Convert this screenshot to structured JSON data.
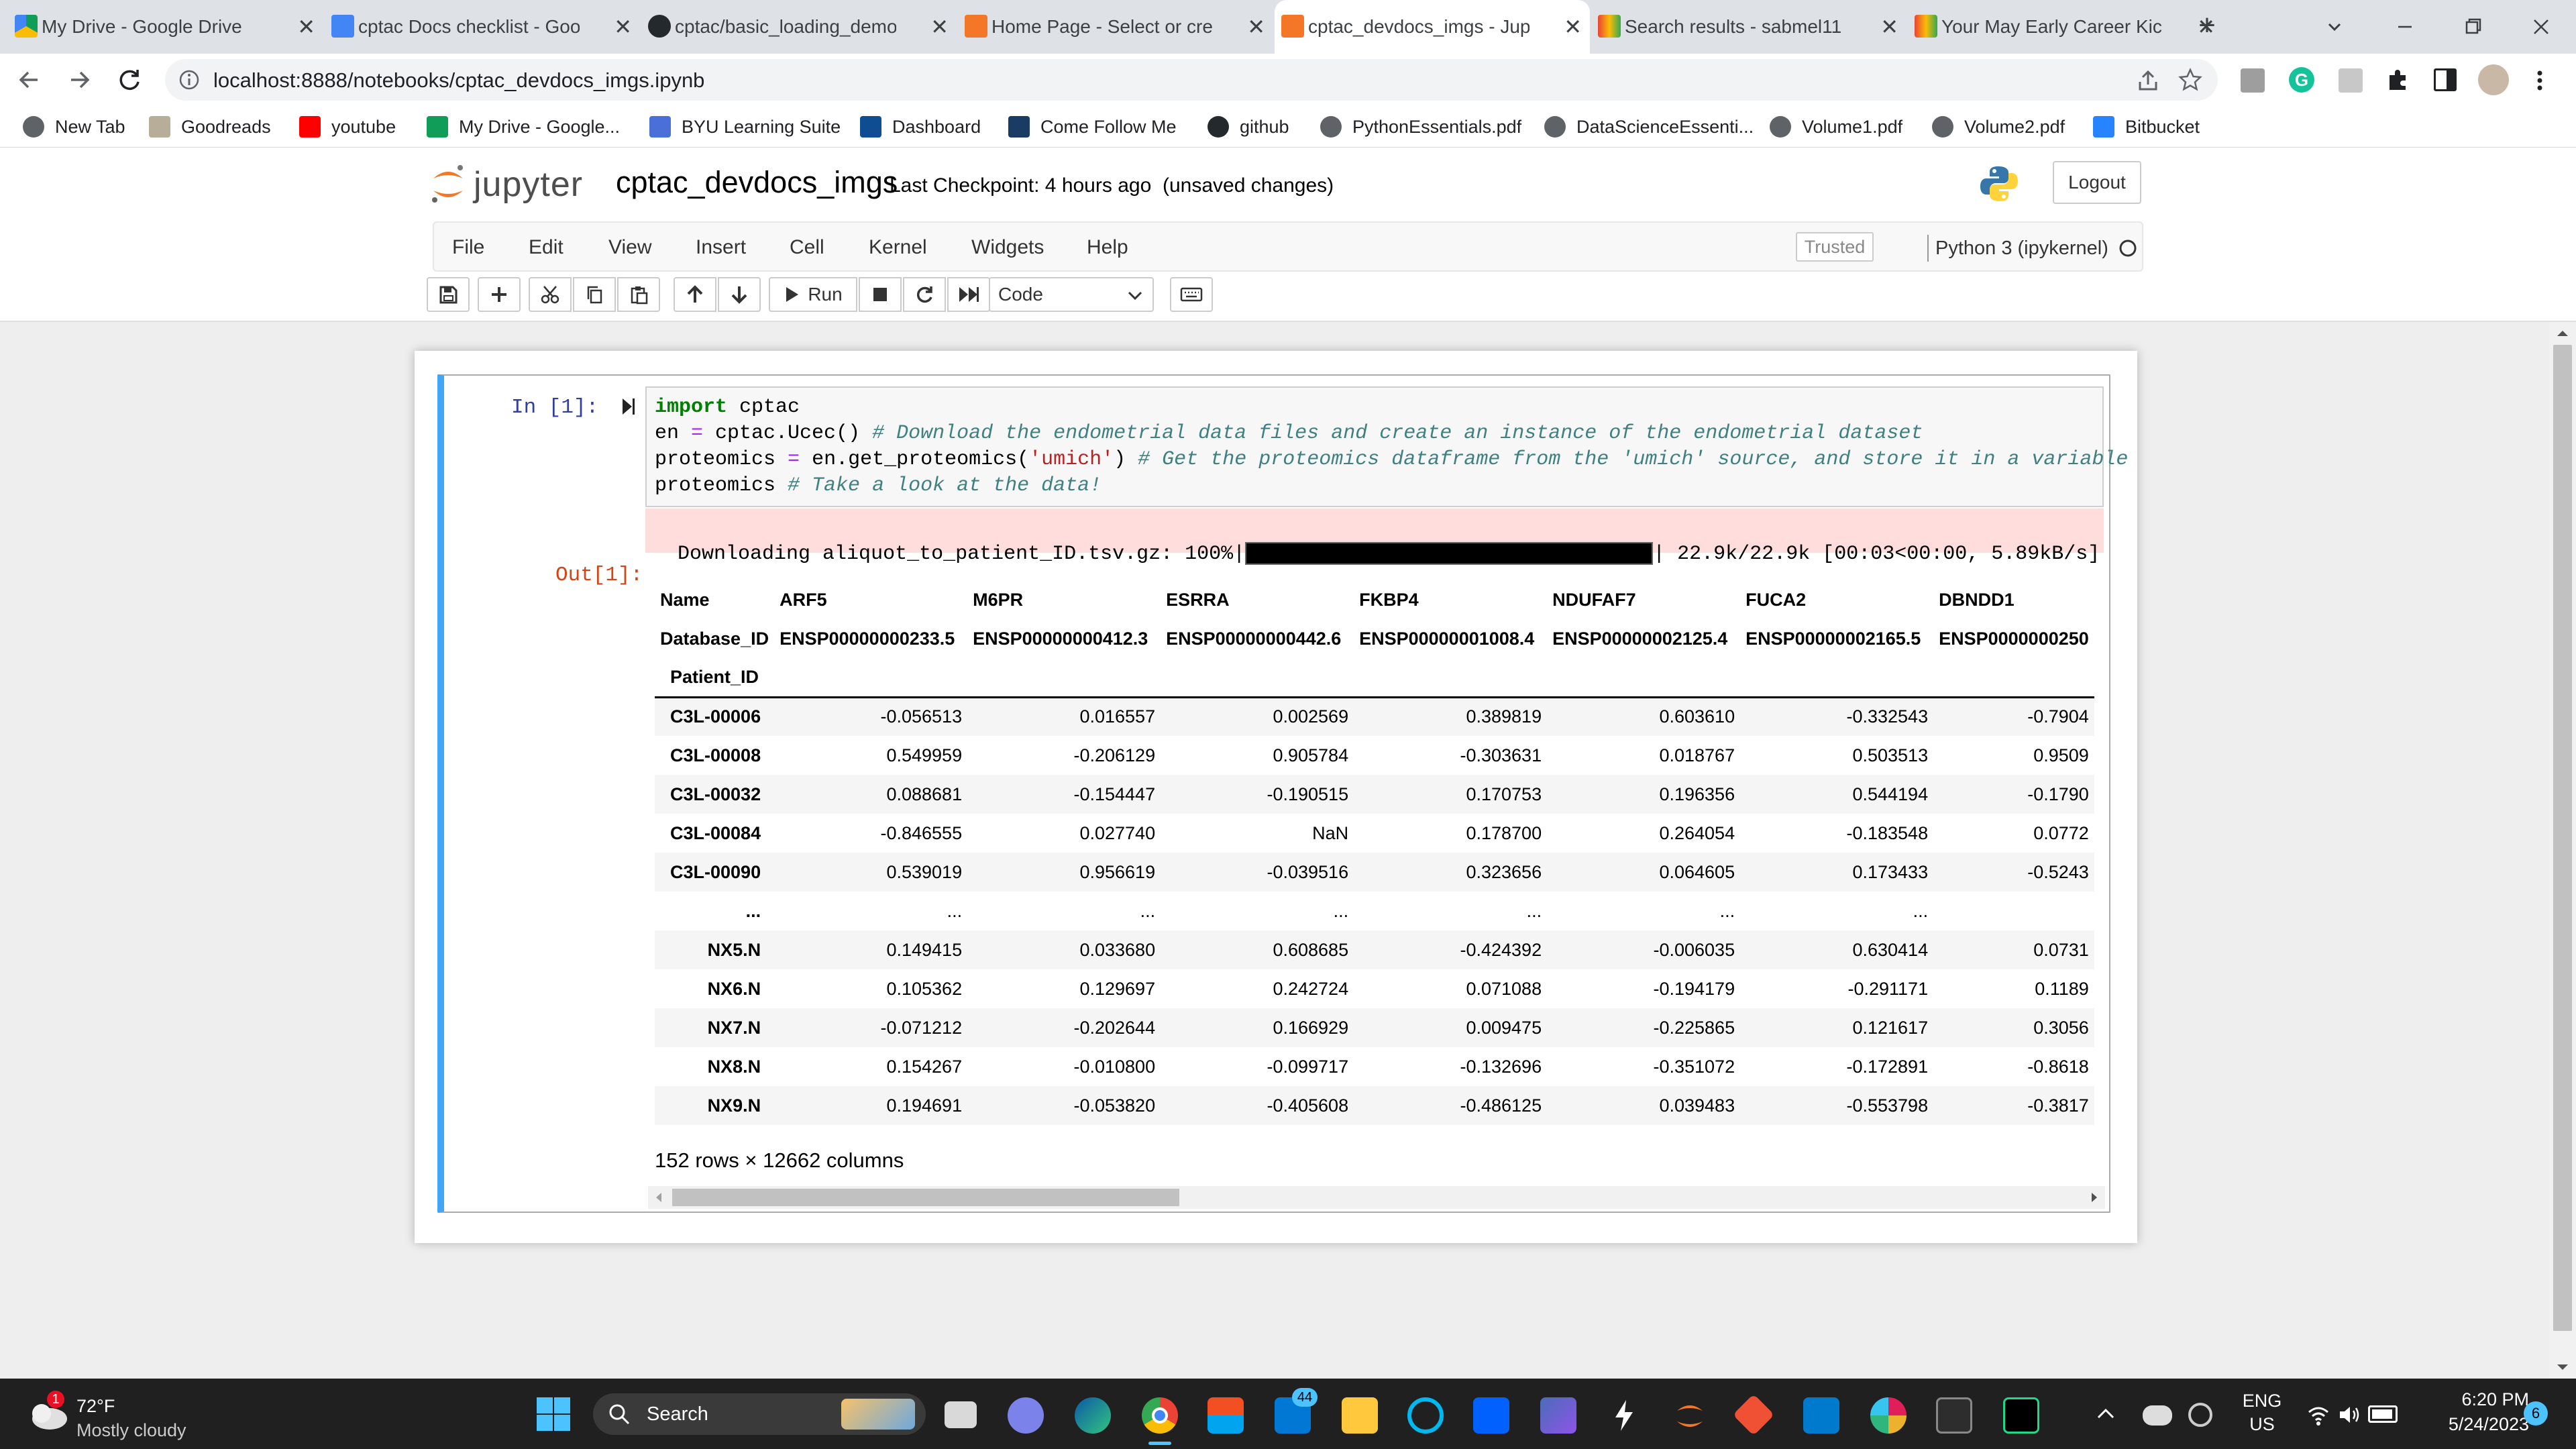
{
  "browser": {
    "tabs": [
      {
        "title": "My Drive - Google Drive",
        "icon": "google-drive-icon",
        "active": false
      },
      {
        "title": "cptac Docs checklist - Goo",
        "icon": "google-docs-icon",
        "active": false
      },
      {
        "title": "cptac/basic_loading_demo",
        "icon": "github-icon",
        "active": false
      },
      {
        "title": "Home Page - Select or cre",
        "icon": "loading-spinner-icon",
        "active": false
      },
      {
        "title": "cptac_devdocs_imgs - Jupy",
        "icon": "jupyter-icon",
        "active": true
      },
      {
        "title": "Search results - sabmel11",
        "icon": "gmail-icon",
        "active": false
      },
      {
        "title": "Your May Early Career Kick",
        "icon": "gmail-icon",
        "active": false
      }
    ],
    "url": "localhost:8888/notebooks/cptac_devdocs_imgs.ipynb",
    "bookmarks": [
      {
        "label": "New Tab",
        "icon": "globe-icon"
      },
      {
        "label": "Goodreads",
        "icon": "goodreads-icon"
      },
      {
        "label": "youtube",
        "icon": "youtube-icon"
      },
      {
        "label": "My Drive - Google...",
        "icon": "google-drive-icon"
      },
      {
        "label": "BYU Learning Suite",
        "icon": "byu-icon"
      },
      {
        "label": "Dashboard",
        "icon": "yale-icon"
      },
      {
        "label": "Come Follow Me",
        "icon": "church-icon"
      },
      {
        "label": "github",
        "icon": "github-icon"
      },
      {
        "label": "PythonEssentials.pdf",
        "icon": "globe-icon"
      },
      {
        "label": "DataScienceEssenti...",
        "icon": "globe-icon"
      },
      {
        "label": "Volume1.pdf",
        "icon": "globe-icon"
      },
      {
        "label": "Volume2.pdf",
        "icon": "globe-icon"
      },
      {
        "label": "Bitbucket",
        "icon": "bitbucket-icon"
      }
    ]
  },
  "jupyter": {
    "logo_text": "jupyter",
    "notebook_name": "cptac_devdocs_imgs",
    "checkpoint": "Last Checkpoint: 4 hours ago",
    "status": "(unsaved changes)",
    "logout": "Logout",
    "menu": [
      "File",
      "Edit",
      "View",
      "Insert",
      "Cell",
      "Kernel",
      "Widgets",
      "Help"
    ],
    "trusted": "Trusted",
    "kernel": "Python 3 (ipykernel)",
    "run_label": "Run",
    "cell_type": "Code"
  },
  "cell": {
    "in_prompt": "In [1]:",
    "out_prompt": "Out[1]:",
    "code_lines": [
      [
        {
          "t": "import",
          "c": "kw"
        },
        {
          "t": " cptac",
          "c": ""
        }
      ],
      [
        {
          "t": "en ",
          "c": ""
        },
        {
          "t": "=",
          "c": "op"
        },
        {
          "t": " cptac.Ucec() ",
          "c": ""
        },
        {
          "t": "# Download the endometrial data files and create an instance of the endometrial dataset",
          "c": "cm"
        }
      ],
      [
        {
          "t": "proteomics ",
          "c": ""
        },
        {
          "t": "=",
          "c": "op"
        },
        {
          "t": " en.get_proteomics(",
          "c": ""
        },
        {
          "t": "'umich'",
          "c": "st"
        },
        {
          "t": ") ",
          "c": ""
        },
        {
          "t": "# Get the proteomics dataframe from the 'umich' source, and store it in a variable",
          "c": "cm"
        }
      ],
      [
        {
          "t": "proteomics ",
          "c": ""
        },
        {
          "t": "# Take a look at the data!",
          "c": "cm"
        }
      ]
    ],
    "stderr_prefix": "Downloading aliquot_to_patient_ID.tsv.gz: 100%|",
    "stderr_suffix": "| 22.9k/22.9k [00:03<00:00, 5.89kB/s]",
    "progress": 1.0
  },
  "dataframe": {
    "col_index_name": "Name",
    "level2_index_name": "Database_ID",
    "row_index_name": "Patient_ID",
    "columns": [
      "ARF5",
      "M6PR",
      "ESRRA",
      "FKBP4",
      "NDUFAF7",
      "FUCA2",
      "DBNDD1"
    ],
    "database_ids": [
      "ENSP00000000233.5",
      "ENSP00000000412.3",
      "ENSP00000000442.6",
      "ENSP00000001008.4",
      "ENSP00000002125.4",
      "ENSP00000002165.5",
      "ENSP0000000250"
    ],
    "rows": [
      {
        "id": "C3L-00006",
        "values": [
          "-0.056513",
          "0.016557",
          "0.002569",
          "0.389819",
          "0.603610",
          "-0.332543",
          "-0.7904"
        ]
      },
      {
        "id": "C3L-00008",
        "values": [
          "0.549959",
          "-0.206129",
          "0.905784",
          "-0.303631",
          "0.018767",
          "0.503513",
          "0.9509"
        ]
      },
      {
        "id": "C3L-00032",
        "values": [
          "0.088681",
          "-0.154447",
          "-0.190515",
          "0.170753",
          "0.196356",
          "0.544194",
          "-0.1790"
        ]
      },
      {
        "id": "C3L-00084",
        "values": [
          "-0.846555",
          "0.027740",
          "NaN",
          "0.178700",
          "0.264054",
          "-0.183548",
          "0.0772"
        ]
      },
      {
        "id": "C3L-00090",
        "values": [
          "0.539019",
          "0.956619",
          "-0.039516",
          "0.323656",
          "0.064605",
          "0.173433",
          "-0.5243"
        ]
      },
      {
        "id": "...",
        "values": [
          "...",
          "...",
          "...",
          "...",
          "...",
          "...",
          ""
        ]
      },
      {
        "id": "NX5.N",
        "values": [
          "0.149415",
          "0.033680",
          "0.608685",
          "-0.424392",
          "-0.006035",
          "0.630414",
          "0.0731"
        ]
      },
      {
        "id": "NX6.N",
        "values": [
          "0.105362",
          "0.129697",
          "0.242724",
          "0.071088",
          "-0.194179",
          "-0.291171",
          "0.1189"
        ]
      },
      {
        "id": "NX7.N",
        "values": [
          "-0.071212",
          "-0.202644",
          "0.166929",
          "0.009475",
          "-0.225865",
          "0.121617",
          "0.3056"
        ]
      },
      {
        "id": "NX8.N",
        "values": [
          "0.154267",
          "-0.010800",
          "-0.099717",
          "-0.132696",
          "-0.351072",
          "-0.172891",
          "-0.8618"
        ]
      },
      {
        "id": "NX9.N",
        "values": [
          "0.194691",
          "-0.053820",
          "-0.405608",
          "-0.486125",
          "0.039483",
          "-0.553798",
          "-0.3817"
        ]
      }
    ],
    "shape_text": "152 rows × 12662 columns"
  },
  "taskbar": {
    "weather_temp": "72°F",
    "weather_desc": "Mostly cloudy",
    "weather_badge": "1",
    "search_label": "Search",
    "mail_badge": "44",
    "lang_top": "ENG",
    "lang_bottom": "US",
    "time": "6:20 PM",
    "date": "5/24/2023",
    "notif_badge": "6"
  }
}
